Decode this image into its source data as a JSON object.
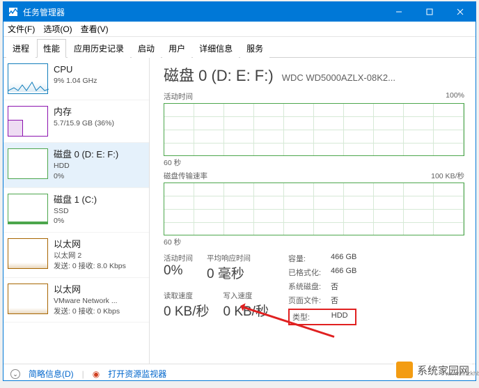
{
  "titlebar": {
    "title": "任务管理器"
  },
  "menubar": {
    "file": "文件(F)",
    "options": "选项(O)",
    "view": "查看(V)"
  },
  "tabs": [
    "进程",
    "性能",
    "应用历史记录",
    "启动",
    "用户",
    "详细信息",
    "服务"
  ],
  "active_tab_index": 1,
  "sidebar": [
    {
      "title": "CPU",
      "line2": "9% 1.04 GHz",
      "line3": "",
      "thumb": "cpu"
    },
    {
      "title": "内存",
      "line2": "5.7/15.9 GB (36%)",
      "line3": "",
      "thumb": "mem"
    },
    {
      "title": "磁盘 0 (D: E: F:)",
      "line2": "HDD",
      "line3": "0%",
      "thumb": "disk0",
      "selected": true
    },
    {
      "title": "磁盘 1 (C:)",
      "line2": "SSD",
      "line3": "0%",
      "thumb": "disk1"
    },
    {
      "title": "以太网",
      "line2": "以太网 2",
      "line3": "发送: 0 接收: 8.0 Kbps",
      "thumb": "net"
    },
    {
      "title": "以太网",
      "line2": "VMware Network ...",
      "line3": "发送: 0 接收: 0 Kbps",
      "thumb": "net"
    }
  ],
  "main": {
    "title": "磁盘 0 (D: E: F:)",
    "model": "WDC WD5000AZLX-08K2...",
    "chart1_label": "活动时间",
    "chart1_max": "100%",
    "chart1_bottom": "60 秒",
    "chart2_label": "磁盘传输速率",
    "chart2_max": "100 KB/秒",
    "chart2_bottom": "60 秒",
    "stats": {
      "active_time_label": "活动时间",
      "active_time": "0%",
      "avg_resp_label": "平均响应时间",
      "avg_resp": "0 毫秒",
      "read_label": "读取速度",
      "read": "0 KB/秒",
      "write_label": "写入速度",
      "write": "0 KB/秒"
    },
    "info": {
      "capacity_k": "容量:",
      "capacity_v": "466 GB",
      "formatted_k": "已格式化:",
      "formatted_v": "466 GB",
      "system_k": "系统磁盘:",
      "system_v": "否",
      "pagefile_k": "页面文件:",
      "pagefile_v": "否",
      "type_k": "类型:",
      "type_v": "HDD"
    }
  },
  "footer": {
    "brief": "简略信息(D)",
    "monitor": "打开资源监视器"
  },
  "watermark": {
    "text": "系统家园网",
    "url": "www.hnzkhbsb.com"
  },
  "chart_data": [
    {
      "type": "line",
      "title": "活动时间",
      "ylim": [
        0,
        100
      ],
      "yunit": "%",
      "x_seconds": 60,
      "values": [
        0,
        0,
        0,
        0,
        0,
        0,
        0,
        0,
        0,
        0,
        0,
        0,
        0,
        0,
        0,
        0,
        0,
        0,
        0,
        0
      ]
    },
    {
      "type": "line",
      "title": "磁盘传输速率",
      "ylim": [
        0,
        100
      ],
      "yunit": "KB/秒",
      "x_seconds": 60,
      "values": [
        0,
        0,
        0,
        0,
        0,
        0,
        0,
        0,
        0,
        0,
        0,
        0,
        0,
        0,
        0,
        0,
        0,
        0,
        0,
        0
      ]
    }
  ]
}
